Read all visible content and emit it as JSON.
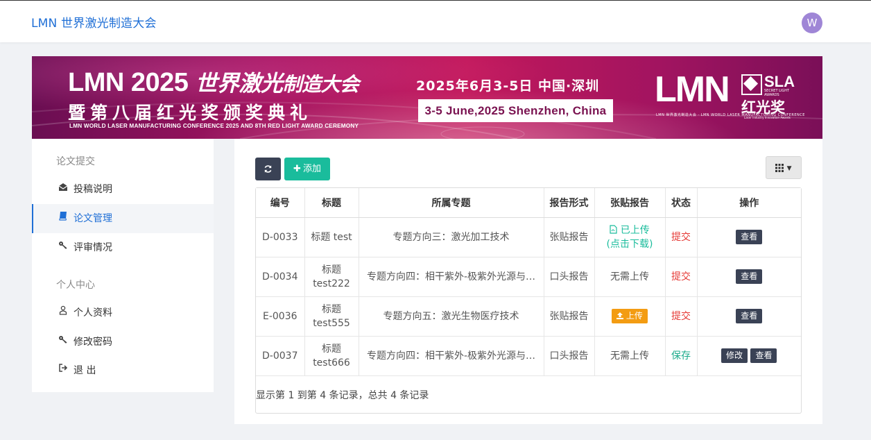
{
  "header": {
    "brand": "LMN 世界激光制造大会",
    "avatar_letter": "W"
  },
  "banner": {
    "title_part1": "LMN 2025",
    "title_part2": "世界激光",
    "title_part3": "制造大会",
    "title_line2": "暨第八届红光奖颁奖典礼",
    "subtitle": "LMN WORLD LASER MANUFACTURING CONFERENCE 2025 AND 8TH RED LIGHT AWARD CEREMONY",
    "date_cn": "2025年6月3-5日  中国·深圳",
    "date_en": "3-5 June,2025 Shenzhen, China",
    "logo_lmn": "LMN",
    "logo_lmn_sub": "LMN 世界激光制造大会 · LMN WORLD LASER MANUFACTURING CONFERENCE",
    "logo_sla": "SLA",
    "logo_sla_sub": "SECRET LIGHT AWARDS",
    "logo_hg": "红光奖",
    "logo_hg_sub": "Laser Industry Innovation Awards"
  },
  "sidebar": {
    "section1": "论文提交",
    "items1": [
      {
        "label": "投稿说明",
        "icon": "envelope-open-icon"
      },
      {
        "label": "论文管理",
        "icon": "book-icon",
        "active": true
      },
      {
        "label": "评审情况",
        "icon": "key-icon"
      }
    ],
    "section2": "个人中心",
    "items2": [
      {
        "label": "个人资料",
        "icon": "user-icon"
      },
      {
        "label": "修改密码",
        "icon": "key-icon"
      },
      {
        "label": "退 出",
        "icon": "sign-out-icon"
      }
    ]
  },
  "toolbar": {
    "refresh_icon": "refresh-icon",
    "add_label": "添加",
    "columns_icon": "grid-icon"
  },
  "table": {
    "headers": [
      "编号",
      "标题",
      "所属专题",
      "报告形式",
      "张贴报告",
      "状态",
      "操作"
    ],
    "rows": [
      {
        "id": "D-0033",
        "title": "标题 test",
        "topic": "专题方向三：激光加工技术",
        "form": "张贴报告",
        "poster_line1": "已上传",
        "poster_line2": "(点击下载)",
        "status": "提交",
        "view": "查看"
      },
      {
        "id": "D-0034",
        "title": "标题 test222",
        "topic": "专题方向四：相干紫外-极紫外光源与…",
        "form": "口头报告",
        "poster": "无需上传",
        "status": "提交",
        "view": "查看"
      },
      {
        "id": "E-0036",
        "title": "标题 test555",
        "topic": "专题方向五：激光生物医疗技术",
        "form": "张贴报告",
        "upload": "上传",
        "status": "提交",
        "view": "查看"
      },
      {
        "id": "D-0037",
        "title": "标题 test666",
        "topic": "专题方向四：相干紫外-极紫外光源与…",
        "form": "口头报告",
        "poster": "无需上传",
        "status": "保存",
        "edit": "修改",
        "view": "查看"
      }
    ],
    "pagination": "显示第 1 到第 4 条记录，总共 4 条记录"
  },
  "colors": {
    "brand": "#1f6fd6",
    "dark_button": "#3a4255",
    "add_button": "#1abc9c",
    "upload_button": "#f39c12",
    "status_submit": "#e53935",
    "status_save": "#1aaa8a"
  }
}
